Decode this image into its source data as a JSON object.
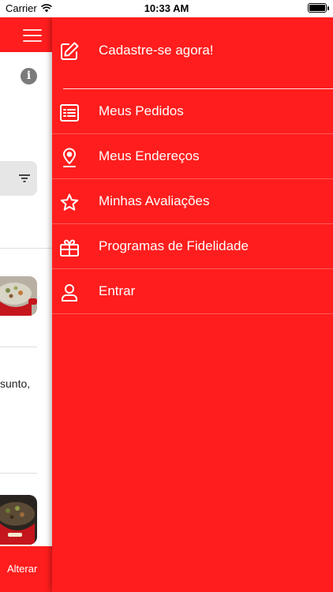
{
  "status_bar": {
    "carrier": "Carrier",
    "time": "10:33 AM"
  },
  "background_page": {
    "text_snippet": "sunto,",
    "bottom_action": "Alterar"
  },
  "drawer": {
    "header": {
      "label": "Cadastre-se agora!",
      "icon": "edit-icon"
    },
    "items": [
      {
        "label": "Meus Pedidos",
        "icon": "list-icon"
      },
      {
        "label": "Meus Endereços",
        "icon": "location-pin-icon"
      },
      {
        "label": "Minhas Avaliações",
        "icon": "star-icon"
      },
      {
        "label": "Programas de Fidelidade",
        "icon": "gift-icon"
      },
      {
        "label": "Entrar",
        "icon": "user-icon"
      }
    ]
  },
  "colors": {
    "primary": "#ff1d1d",
    "muted_icon": "#7b7b7b"
  }
}
